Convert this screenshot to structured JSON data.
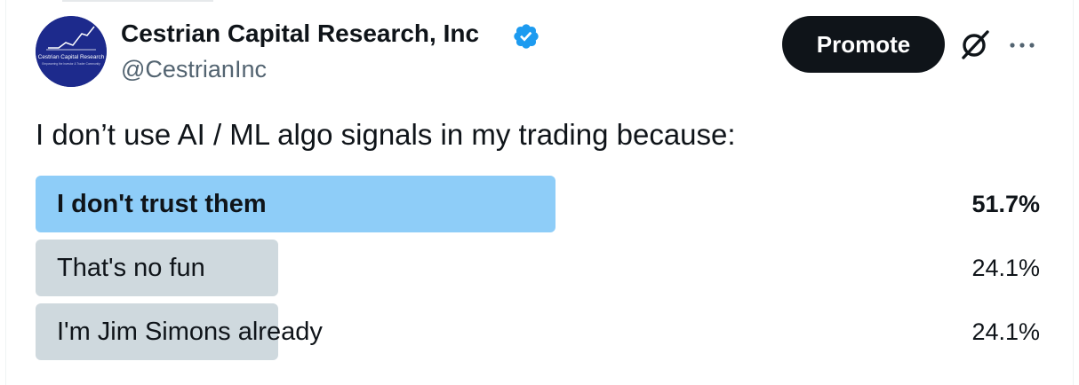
{
  "tweet": {
    "author": {
      "name": "Cestrian Capital Research, Inc",
      "handle": "@CestrianInc",
      "verified": true,
      "avatar_text": "Cestrian Capital Research",
      "avatar_subtext": "Empowering the Investor & Trader Community"
    },
    "actions": {
      "promote_label": "Promote",
      "grok_icon": "grok-icon",
      "more_icon": "more-horizontal-icon"
    },
    "text": "I don’t use AI / ML algo signals in my trading because:",
    "poll": {
      "options": [
        {
          "label": "I don't trust them",
          "percent_text": "51.7%",
          "percent": 51.7,
          "winner": true
        },
        {
          "label": "That's no fun",
          "percent_text": "24.1%",
          "percent": 24.1,
          "winner": false
        },
        {
          "label": "I'm Jim Simons already",
          "percent_text": "24.1%",
          "percent": 24.1,
          "winner": false
        }
      ]
    }
  },
  "colors": {
    "text": "#0f1419",
    "secondary_text": "#536471",
    "winner_bar": "#8ecdf8",
    "other_bar": "#cfd9de",
    "verified_badge": "#1d9bf0",
    "avatar_bg": "#1d2a8c",
    "promote_bg": "#0f1419"
  }
}
